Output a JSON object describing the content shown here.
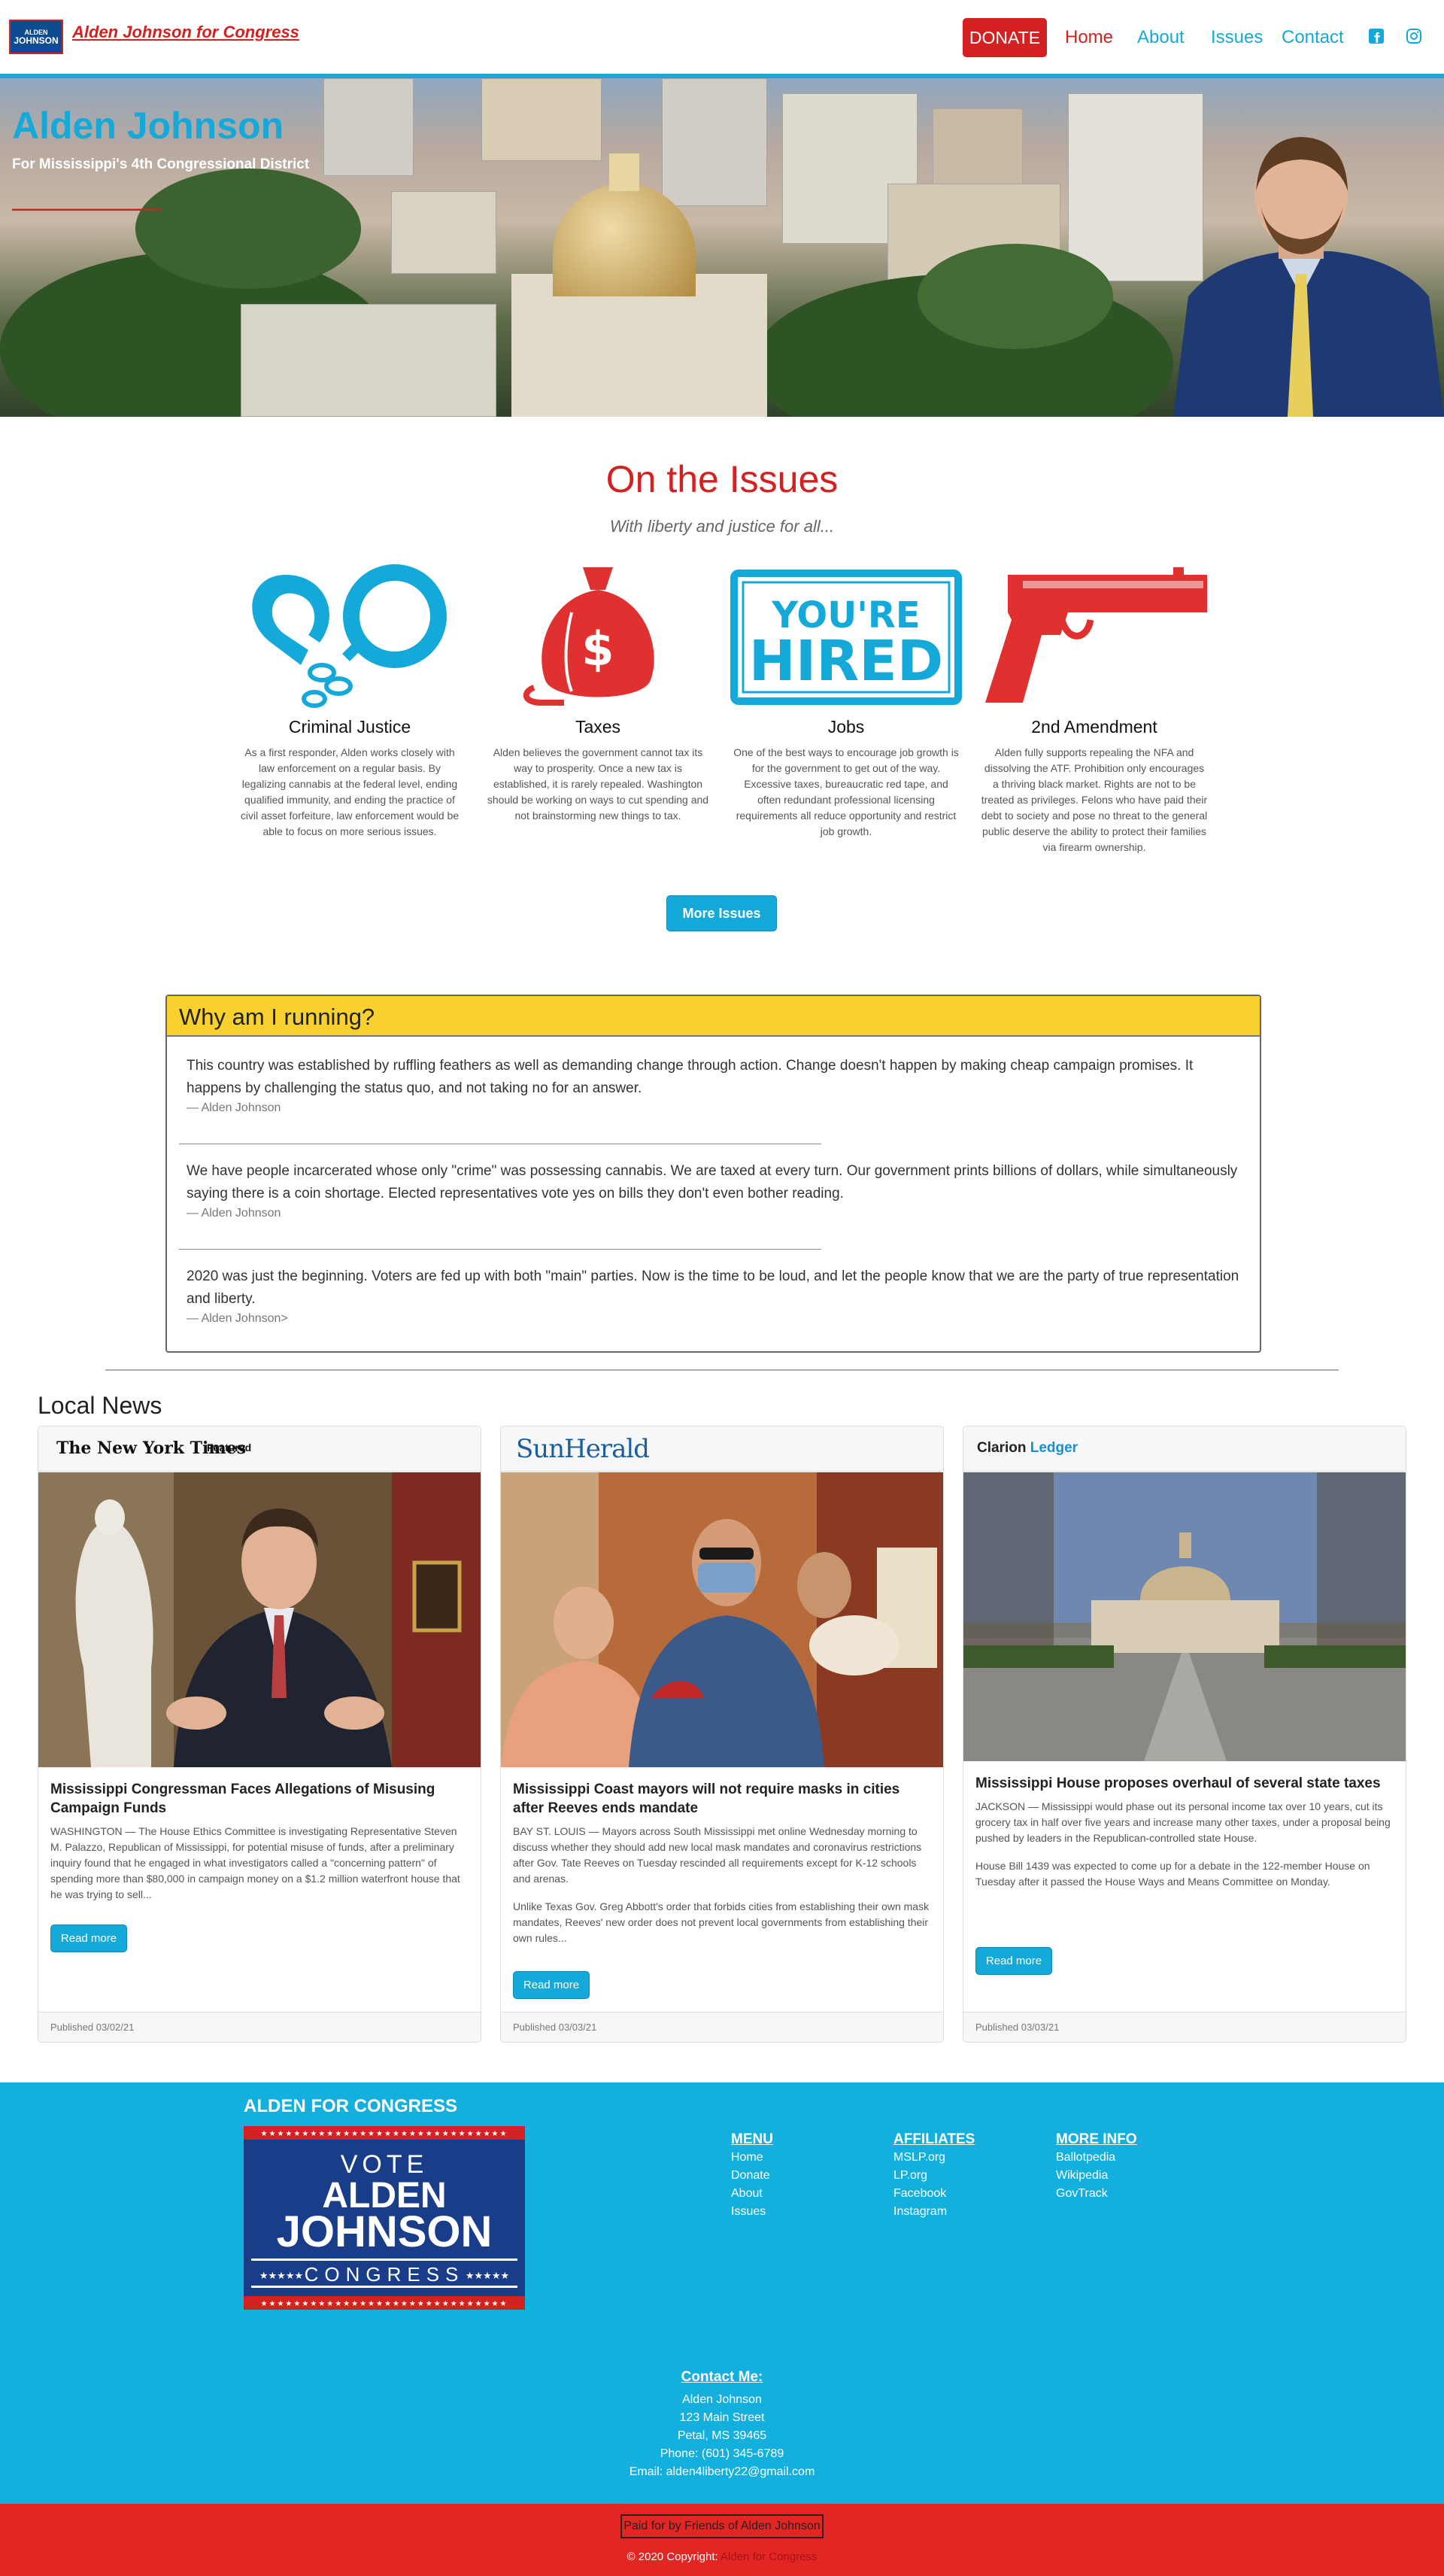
{
  "nav": {
    "logo": {
      "line1": "ALDEN",
      "line2": "JOHNSON"
    },
    "brand": "Alden Johnson for Congress",
    "donate": "DONATE",
    "links": [
      "Home",
      "About",
      "Issues",
      "Contact"
    ],
    "social": [
      "facebook-icon",
      "instagram-icon"
    ],
    "colors": {
      "accent": "#14a9d8",
      "red": "#d32020",
      "yellow": "#f8d12f"
    }
  },
  "hero": {
    "title": "Alden Johnson",
    "subtitle": "For Mississippi's 4th Congressional District"
  },
  "issues": {
    "title": "On the Issues",
    "subtitle": "With liberty and justice for all...",
    "items": [
      {
        "name": "Criminal Justice",
        "icon": "handcuffs-icon",
        "text": "As a first responder, Alden works closely with law enforcement on a regular basis. By legalizing cannabis at the federal level, ending qualified immunity, and ending the practice of civil asset forfeiture, law enforcement would be able to focus on more serious issues."
      },
      {
        "name": "Taxes",
        "icon": "money-bag-icon",
        "text": "Alden believes the government cannot tax its way to prosperity. Once a new tax is established, it is rarely repealed. Washington should be working on ways to cut spending and not brainstorming new things to tax."
      },
      {
        "name": "Jobs",
        "icon": "youre-hired-stamp-icon",
        "stamp_line1": "YOU'RE",
        "stamp_line2": "HIRED",
        "text": "One of the best ways to encourage job growth is for the government to get out of the way. Excessive taxes, bureaucratic red tape, and often redundant professional licensing requirements all reduce opportunity and restrict job growth."
      },
      {
        "name": "2nd Amendment",
        "icon": "pistol-icon",
        "text": "Alden fully supports repealing the NFA and dissolving the ATF. Prohibition only encourages a thriving black market. Rights are not to be treated as privileges. Felons who have paid their debt to society and pose no threat to the general public deserve the ability to protect their families via firearm ownership."
      }
    ],
    "more_button": "More Issues"
  },
  "why": {
    "title": "Why am I running?",
    "quotes": [
      {
        "text": "This country was established by ruffling feathers as well as demanding change through action. Change doesn't happen by making cheap campaign promises. It happens by challenging the status quo, and not taking no for an answer.",
        "by": "— Alden Johnson"
      },
      {
        "text": "We have people incarcerated whose only \"crime\" was possessing cannabis. We are taxed at every turn. Our government prints billions of dollars, while simultaneously saying there is a coin shortage. Elected representatives vote yes on bills they don't even bother reading.",
        "by": "— Alden Johnson"
      },
      {
        "text": "2020 was just the beginning. Voters are fed up with both \"main\" parties. Now is the time to be loud, and let the people know that we are the party of true representation and liberty.",
        "by": "— Alden Johnson>"
      }
    ]
  },
  "news": {
    "title": "Local News",
    "cards": [
      {
        "source": "The New York Times",
        "badge": "Featured",
        "headline": "Mississippi Congressman Faces Allegations of Misusing Campaign Funds",
        "paragraphs": [
          "WASHINGTON — The House Ethics Committee is investigating Representative Steven M. Palazzo, Republican of Mississippi, for potential misuse of funds, after a preliminary inquiry found that he engaged in what investigators called a \"concerning pattern\" of spending more than $80,000 in campaign money on a $1.2 million waterfront house that he was trying to sell..."
        ],
        "button": "Read more",
        "published": "Published 03/02/21"
      },
      {
        "source": "SunHerald",
        "headline": "Mississippi Coast mayors will not require masks in cities after Reeves ends mandate",
        "paragraphs": [
          "BAY ST. LOUIS — Mayors across South Mississippi met online Wednesday morning to discuss whether they should add new local mask mandates and coronavirus restrictions after Gov. Tate Reeves on Tuesday rescinded all requirements except for K-12 schools and arenas.",
          "Unlike Texas Gov. Greg Abbott's order that forbids cities from establishing their own mask mandates, Reeves' new order does not prevent local governments from establishing their own rules..."
        ],
        "button": "Read more",
        "published": "Published 03/03/21"
      },
      {
        "source_a": "Clarion",
        "source_b": "Ledger",
        "headline": "Mississippi House proposes overhaul of several state taxes",
        "paragraphs": [
          "JACKSON — Mississippi would phase out its personal income tax over 10 years, cut its grocery tax in half over five years and increase many other taxes, under a proposal being pushed by leaders in the Republican-controlled state House.",
          "House Bill 1439 was expected to come up for a debate in the 122-member House on Tuesday after it passed the House Ways and Means Committee on Monday."
        ],
        "button": "Read more",
        "published": "Published 03/03/21"
      }
    ]
  },
  "footer": {
    "title": "ALDEN FOR CONGRESS",
    "logo": {
      "vote": "VOTE",
      "first": "ALDEN",
      "last": "JOHNSON",
      "office": "CONGRESS",
      "stars": "★★★★★"
    },
    "menu": {
      "heading": "MENU",
      "items": [
        "Home",
        "Donate",
        "About",
        "Issues"
      ]
    },
    "affiliates": {
      "heading": "AFFILIATES",
      "items": [
        "MSLP.org",
        "LP.org",
        "Facebook",
        "Instagram"
      ]
    },
    "more": {
      "heading": "MORE INFO",
      "items": [
        "Ballotpedia",
        "Wikipedia",
        "GovTrack"
      ]
    },
    "contact": {
      "heading": "Contact Me:",
      "name": "Alden Johnson",
      "street": "123 Main Street",
      "city": "Petal, MS 39465",
      "phone": "Phone: (601) 345-6789",
      "email": "Email: alden4liberty22@gmail.com"
    },
    "paid": "Paid for by Friends of Alden Johnson",
    "copyright": "© 2020 Copyright:",
    "copyright_link": "Alden for Congress"
  }
}
